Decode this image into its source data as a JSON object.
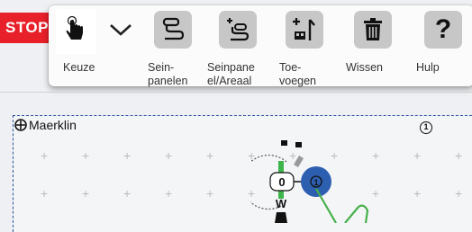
{
  "stop_label": "STOP",
  "toolbar": {
    "items": [
      {
        "label": "Keuze",
        "icon": "hand-pointer-icon"
      },
      {
        "label": "",
        "icon": "chevron-down-icon"
      },
      {
        "label": "Sein-\npanelen",
        "icon": "signal-panels-icon"
      },
      {
        "label": "Seinpane\nel/Areaal",
        "icon": "signal-panel-area-icon"
      },
      {
        "label": "Toe-\nvoegen",
        "icon": "add-item-icon"
      },
      {
        "label": "Wissen",
        "icon": "trash-icon"
      },
      {
        "label": "Hulp",
        "icon": "help-icon"
      }
    ]
  },
  "layout": {
    "area_name": "Maerklin",
    "signal_value": "0",
    "signal_letter": "W",
    "info_symbol": "1"
  },
  "colors": {
    "stop": "#e8202a",
    "area_border": "#2b4fa3",
    "signal_blue": "#2d5fb0",
    "signal_green": "#3db54a",
    "cursor_green": "#46b04a"
  }
}
